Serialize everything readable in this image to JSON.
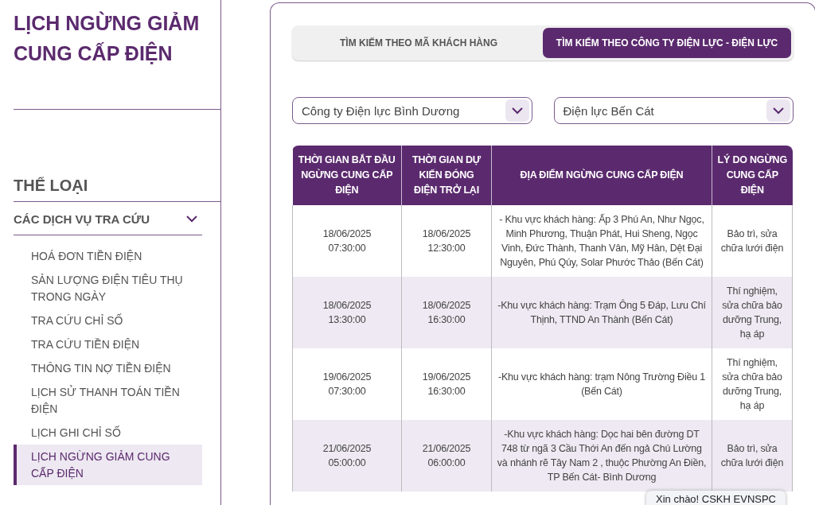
{
  "sidebar": {
    "page_title": "LỊCH NGỪNG GIẢM CUNG CẤP ĐIỆN",
    "category_heading": "THỂ LOẠI",
    "group": {
      "label": "CÁC DỊCH VỤ TRA CỨU",
      "expanded": true,
      "items": [
        {
          "label": "HOÁ ĐƠN TIỀN ĐIỆN",
          "selected": false
        },
        {
          "label": "SẢN LƯỢNG ĐIỆN TIÊU THỤ TRONG NGÀY",
          "selected": false
        },
        {
          "label": "TRA CỨU CHỈ SỐ",
          "selected": false
        },
        {
          "label": "TRA CỨU TIỀN ĐIỆN",
          "selected": false
        },
        {
          "label": "THÔNG TIN NỢ TIỀN ĐIỆN",
          "selected": false
        },
        {
          "label": "LỊCH SỬ THANH TOÁN TIỀN ĐIỆN",
          "selected": false
        },
        {
          "label": "LỊCH GHI CHỈ SỐ",
          "selected": false
        },
        {
          "label": "LỊCH NGỪNG GIẢM CUNG CẤP ĐIỆN",
          "selected": true
        }
      ]
    }
  },
  "tabs": [
    {
      "label": "TÌM KIẾM THEO MÃ KHÁCH HÀNG",
      "selected": false
    },
    {
      "label": "TÌM KIẾM THEO CÔNG TY ĐIỆN LỰC - ĐIỆN LỰC",
      "selected": true
    }
  ],
  "dropdowns": [
    {
      "value": "Công ty Điện lực Bình Dương"
    },
    {
      "value": "Điện lực Bến Cát"
    }
  ],
  "table": {
    "columns": [
      "THỜI GIAN BẮT ĐẦU NGỪNG CUNG CẤP ĐIỆN",
      "THỜI GIAN DỰ KIẾN ĐÓNG ĐIỆN TRỞ LẠI",
      "ĐỊA ĐIỂM NGỪNG CUNG CẤP ĐIỆN",
      "LÝ DO NGỪNG CUNG CẤP ĐIỆN"
    ],
    "rows": [
      {
        "start": "18/06/2025 07:30:00",
        "end": "18/06/2025 12:30:00",
        "location": "- Khu vực khách hàng: Ấp 3 Phú An, Như Ngọc, Minh Phương, Thuận Phát, Hui Sheng, Ngọc Vinh, Đức Thành, Thanh Vân, Mỹ Hân, Dệt Đại Nguyên, Phú Qúy, Solar Phước Thảo (Bến Cát)",
        "reason": "Bảo trì, sửa chữa lưới điện"
      },
      {
        "start": "18/06/2025 13:30:00",
        "end": "18/06/2025 16:30:00",
        "location": "-Khu vực khách hàng: Trạm Ông 5 Đáp, Lưu Chí Thịnh, TTND An Thành (Bến Cát)",
        "reason": "Thí nghiệm, sửa chữa bảo dưỡng Trung, hạ áp"
      },
      {
        "start": "19/06/2025 07:30:00",
        "end": "19/06/2025 16:30:00",
        "location": "-Khu vực khách hàng: trạm Nông Trường Điều 1 (Bến Cát)",
        "reason": "Thí nghiệm, sửa chữa bảo dưỡng Trung, hạ áp"
      },
      {
        "start": "21/06/2025 05:00:00",
        "end": "21/06/2025 06:00:00",
        "location": "-Khu vực khách hàng: Dọc hai bên đường DT 748 từ ngã 3 Cầu Thới An đến ngả Chú Lường và nhánh rẽ Tây Nam 2 , thuộc Phường An Điền, TP Bến Cát- Bình Dương",
        "reason": "Bảo trì, sửa chữa lưới điện"
      }
    ]
  },
  "chat_bubble": {
    "text": "Xin chào! CSKH EVNSPC"
  }
}
